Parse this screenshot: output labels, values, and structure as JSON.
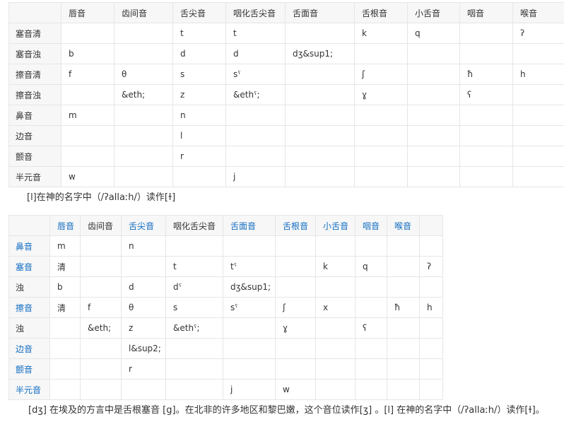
{
  "table1": {
    "header": [
      "",
      "唇音",
      "齿间音",
      "舌尖音",
      "咽化舌尖音",
      "舌面音",
      "舌根音",
      "小舌音",
      "咽音",
      "喉音"
    ],
    "rows": [
      [
        "塞音清",
        "",
        "",
        "t",
        "t",
        "",
        "k",
        "q",
        "",
        "ʔ"
      ],
      [
        "塞音浊",
        "b",
        "",
        "d",
        "d",
        "dʒ&sup1;",
        "",
        "",
        "",
        ""
      ],
      [
        "擦音清",
        "f",
        "θ",
        "s",
        "sˤ",
        "",
        "ʃ",
        "",
        "ħ",
        "h"
      ],
      [
        "擦音浊",
        "",
        "&eth;",
        "z",
        "&ethˤ;",
        "",
        "ɣ",
        "",
        "ʕ",
        ""
      ],
      [
        "鼻音",
        "m",
        "",
        "n",
        "",
        "",
        "",
        "",
        "",
        ""
      ],
      [
        "边音",
        "",
        "",
        "l",
        "",
        "",
        "",
        "",
        "",
        ""
      ],
      [
        "颤音",
        "",
        "",
        "r",
        "",
        "",
        "",
        "",
        "",
        ""
      ],
      [
        "半元音",
        "w",
        "",
        "",
        "j",
        "",
        "",
        "",
        "",
        ""
      ]
    ]
  },
  "note1": "[l]在神的名字中（/ʔallaːh/）读作[ɫ]",
  "table2": {
    "header": [
      "",
      "唇音",
      "齿间音",
      "舌尖音",
      "咽化舌尖音",
      "舌面音",
      "舌根音",
      "小舌音",
      "咽音",
      "喉音",
      ""
    ],
    "rows": [
      [
        "鼻音",
        "m",
        "",
        "n",
        "",
        "",
        "",
        "",
        "",
        "",
        ""
      ],
      [
        "塞音",
        "清",
        "",
        "",
        "t",
        "tˤ",
        "",
        "k",
        "q",
        "",
        "ʔ"
      ],
      [
        "浊",
        "b",
        "",
        "d",
        "dˤ",
        "dʒ&sup1;",
        "",
        "",
        "",
        "",
        ""
      ],
      [
        "擦音",
        "清",
        "f",
        "θ",
        "s",
        "sˤ",
        "ʃ",
        "x",
        "",
        "ħ",
        "h"
      ],
      [
        "浊",
        "",
        "&eth;",
        "z",
        "&ethˤ;",
        "",
        "ɣ",
        "",
        "ʕ",
        "",
        ""
      ],
      [
        "边音",
        "",
        "",
        "l&sup2;",
        "",
        "",
        "",
        "",
        "",
        "",
        ""
      ],
      [
        "颤音",
        "",
        "",
        "r",
        "",
        "",
        "",
        "",
        "",
        "",
        ""
      ],
      [
        "半元音",
        "",
        "",
        "",
        "",
        "j",
        "w",
        "",
        "",
        "",
        ""
      ]
    ]
  },
  "note2": "[dʒ] 在埃及的方言中是舌根塞音 [g]。在北非的许多地区和黎巴嫩，这个音位读作[ʒ] 。[l] 在神的名字中（/ʔallaːh/）读作[ɫ]。",
  "colors": {
    "link": "#136ec2",
    "border": "#e6e6e6",
    "header_bg": "#f7f7f7",
    "text": "#333333"
  }
}
